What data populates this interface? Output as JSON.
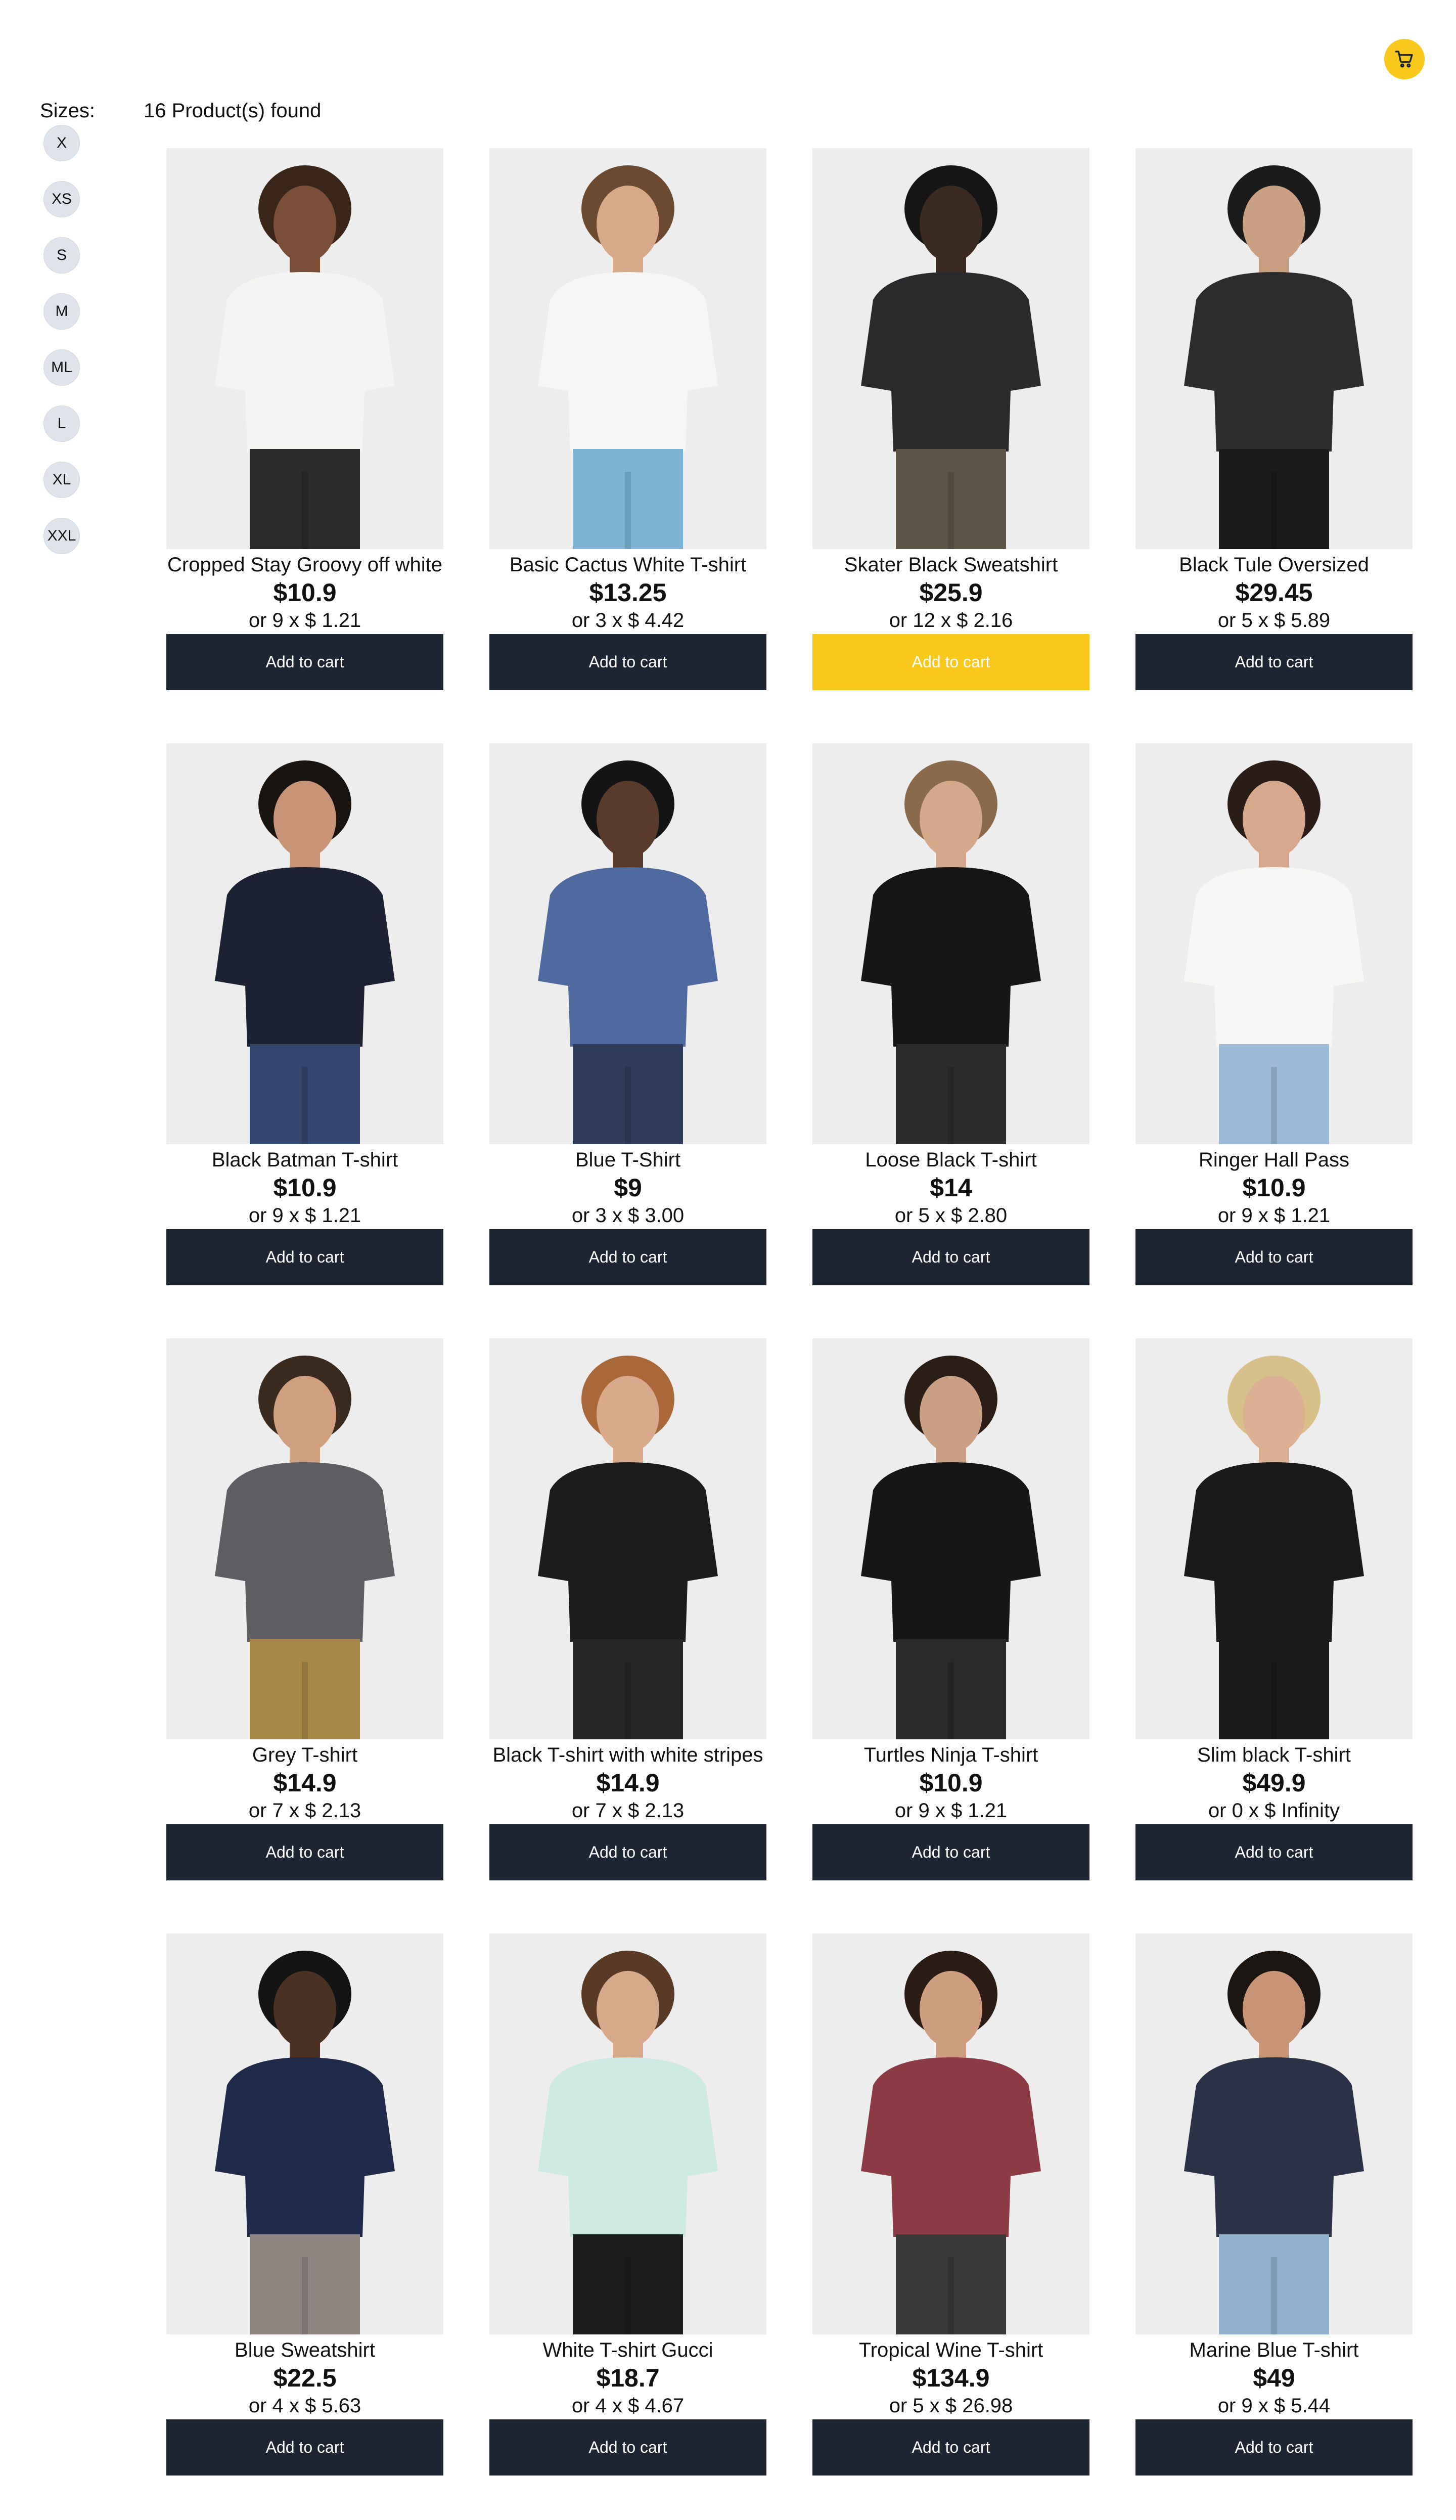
{
  "header": {
    "cart_icon": "shopping-cart-icon",
    "cart_color": "#f8c81c"
  },
  "filters": {
    "sizes_label": "Sizes:",
    "sizes": [
      "X",
      "XS",
      "S",
      "M",
      "ML",
      "L",
      "XL",
      "XXL"
    ]
  },
  "results": {
    "count_text": "16 Product(s) found"
  },
  "colors": {
    "button_dark": "#1d2533",
    "button_highlight": "#f8c81c",
    "size_chip": "#dfe3ea"
  },
  "products": [
    {
      "title": "Cropped Stay Groovy off white",
      "price": "$10.9",
      "installment": "or 9 x $ 1.21",
      "button": "Add to cart",
      "highlight": false,
      "shirt": "#f4f4f2",
      "pants": "#2b2b2b",
      "skin": "#7a4e37",
      "hair": "#3a2518"
    },
    {
      "title": "Basic Cactus White T-shirt",
      "price": "$13.25",
      "installment": "or 3 x $ 4.42",
      "button": "Add to cart",
      "highlight": false,
      "shirt": "#f6f6f4",
      "pants": "#7db3d6",
      "skin": "#d8a989",
      "hair": "#6b4a30"
    },
    {
      "title": "Skater Black Sweatshirt",
      "price": "$25.9",
      "installment": "or 12 x $ 2.16",
      "button": "Add to cart",
      "highlight": true,
      "shirt": "#2a2a2c",
      "pants": "#5d5646",
      "skin": "#3b2a22",
      "hair": "#151515"
    },
    {
      "title": "Black Tule Oversized",
      "price": "$29.45",
      "installment": "or 5 x $ 5.89",
      "button": "Add to cart",
      "highlight": false,
      "shirt": "#2c2c2c",
      "pants": "#1b1b1b",
      "skin": "#caa083",
      "hair": "#1b1b1b"
    },
    {
      "title": "Black Batman T-shirt",
      "price": "$10.9",
      "installment": "or 9 x $ 1.21",
      "button": "Add to cart",
      "highlight": false,
      "shirt": "#1c2233",
      "pants": "#33466e",
      "skin": "#c79478",
      "hair": "#1a1410"
    },
    {
      "title": "Blue T-Shirt",
      "price": "$9",
      "installment": "or 3 x $ 3.00",
      "button": "Add to cart",
      "highlight": false,
      "shirt": "#4e6a9e",
      "pants": "#2e3b5a",
      "skin": "#5a3a2a",
      "hair": "#141414"
    },
    {
      "title": "Loose Black T-shirt",
      "price": "$14",
      "installment": "or 5 x $ 2.80",
      "button": "Add to cart",
      "highlight": false,
      "shirt": "#161616",
      "pants": "#2b2b2b",
      "skin": "#d4a88a",
      "hair": "#8a6a4a"
    },
    {
      "title": "Ringer Hall Pass",
      "price": "$10.9",
      "installment": "or 9 x $ 1.21",
      "button": "Add to cart",
      "highlight": false,
      "shirt": "#f7f7f5",
      "pants": "#9bbbd8",
      "skin": "#d6a98c",
      "hair": "#2a1c16"
    },
    {
      "title": "Grey T-shirt",
      "price": "$14.9",
      "installment": "or 7 x $ 2.13",
      "button": "Add to cart",
      "highlight": false,
      "shirt": "#5e5d62",
      "pants": "#a88748",
      "skin": "#cf9f80",
      "hair": "#3b2a1e"
    },
    {
      "title": "Black T-shirt with white stripes",
      "price": "$14.9",
      "installment": "or 7 x $ 2.13",
      "button": "Add to cart",
      "highlight": false,
      "shirt": "#1c1c1c",
      "pants": "#262626",
      "skin": "#d8a98a",
      "hair": "#a8683a"
    },
    {
      "title": "Turtles Ninja T-shirt",
      "price": "$10.9",
      "installment": "or 9 x $ 1.21",
      "button": "Add to cart",
      "highlight": false,
      "shirt": "#161616",
      "pants": "#2a2a2a",
      "skin": "#caa084",
      "hair": "#2b1e16"
    },
    {
      "title": "Slim black T-shirt",
      "price": "$49.9",
      "installment": "or 0 x $ Infinity",
      "button": "Add to cart",
      "highlight": false,
      "shirt": "#1a1a1a",
      "pants": "#1a1a1a",
      "skin": "#dbb093",
      "hair": "#d7c08a"
    },
    {
      "title": "Blue Sweatshirt",
      "price": "$22.5",
      "installment": "or 4 x $ 5.63",
      "button": "Add to cart",
      "highlight": false,
      "shirt": "#1f2a4a",
      "pants": "#8e8581",
      "skin": "#4b3124",
      "hair": "#141414"
    },
    {
      "title": "White T-shirt Gucci",
      "price": "$18.7",
      "installment": "or 4 x $ 4.67",
      "button": "Add to cart",
      "highlight": false,
      "shirt": "#cdebe3",
      "pants": "#1c1c1c",
      "skin": "#d7a88a",
      "hair": "#5a3a25"
    },
    {
      "title": "Tropical Wine T-shirt",
      "price": "$134.9",
      "installment": "or 5 x $ 26.98",
      "button": "Add to cart",
      "highlight": false,
      "shirt": "#8c3b45",
      "pants": "#3a3a3a",
      "skin": "#cf9e80",
      "hair": "#2b1d15"
    },
    {
      "title": "Marine Blue T-shirt",
      "price": "$49",
      "installment": "or 9 x $ 5.44",
      "button": "Add to cart",
      "highlight": false,
      "shirt": "#2b3247",
      "pants": "#8fb0cf",
      "skin": "#c89476",
      "hair": "#1c1612"
    }
  ]
}
